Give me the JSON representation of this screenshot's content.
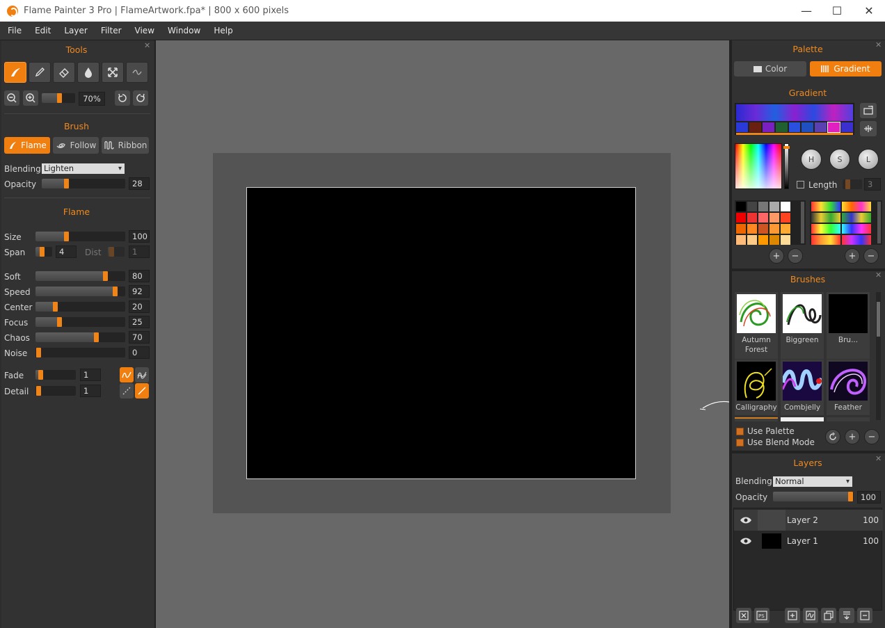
{
  "window": {
    "title": "Flame Painter 3 Pro | FlameArtwork.fpa* | 800 x 600 pixels",
    "minimize": "—",
    "maximize": "☐",
    "close": "✕"
  },
  "menu": [
    "File",
    "Edit",
    "Layer",
    "Filter",
    "View",
    "Window",
    "Help"
  ],
  "tools": {
    "title": "Tools",
    "close": "✕",
    "zoom_value": "70%"
  },
  "brush": {
    "title": "Brush",
    "modes": [
      {
        "label": "Flame"
      },
      {
        "label": "Follow"
      },
      {
        "label": "Ribbon"
      }
    ],
    "blending_label": "Blending",
    "blending_value": "Lighten",
    "opacity_label": "Opacity",
    "opacity_value": "28"
  },
  "flame": {
    "title": "Flame",
    "size_label": "Size",
    "size_value": "100",
    "span_label": "Span",
    "span_value": "4",
    "dist_label": "Dist",
    "dist_value": "1",
    "soft_label": "Soft",
    "soft_value": "80",
    "speed_label": "Speed",
    "speed_value": "92",
    "center_label": "Center",
    "center_value": "20",
    "focus_label": "Focus",
    "focus_value": "25",
    "chaos_label": "Chaos",
    "chaos_value": "70",
    "noise_label": "Noise",
    "noise_value": "0",
    "fade_label": "Fade",
    "fade_value": "1",
    "detail_label": "Detail",
    "detail_value": "1"
  },
  "palette": {
    "title": "Palette",
    "close": "✕",
    "color_label": "Color",
    "gradient_label": "Gradient",
    "gradient_title": "Gradient",
    "h": "H",
    "s": "S",
    "l": "L",
    "length_label": "Length",
    "length_value": "3"
  },
  "brushes": {
    "title": "Brushes",
    "close": "✕",
    "items": [
      {
        "name": "Autumn Forest"
      },
      {
        "name": "Biggreen"
      },
      {
        "name": "Bru..."
      },
      {
        "name": "Calligraphy"
      },
      {
        "name": "Combjelly"
      },
      {
        "name": "Feather"
      }
    ],
    "use_palette": "Use Palette",
    "use_blend_mode": "Use Blend Mode"
  },
  "layers": {
    "title": "Layers",
    "close": "✕",
    "blending_label": "Blending",
    "blending_value": "Normal",
    "opacity_label": "Opacity",
    "opacity_value": "100",
    "rows": [
      {
        "name": "Layer 2",
        "opacity": "100"
      },
      {
        "name": "Layer 1",
        "opacity": "100"
      }
    ]
  }
}
